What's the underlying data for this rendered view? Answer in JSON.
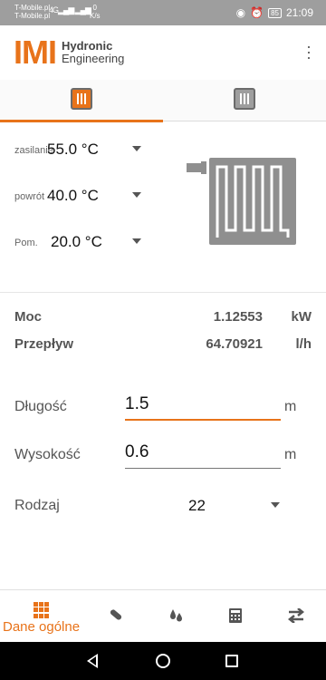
{
  "status_bar": {
    "carrier_1": "T-Mobile.pl",
    "carrier_2": "T-Mobile.pl",
    "signal": "4G",
    "speed_value": "0",
    "speed_unit": "K/s",
    "battery": "85",
    "time": "21:09"
  },
  "header": {
    "logo_mark": "IMI",
    "logo_line1": "Hydronic",
    "logo_line2": "Engineering"
  },
  "tabs": [
    {
      "name": "panel-radiator",
      "active": true
    },
    {
      "name": "vertical-radiator",
      "active": false
    }
  ],
  "temperatures": {
    "supply": {
      "label": "zasilanie",
      "value": "55.0 °C"
    },
    "return": {
      "label": "powrót",
      "value": "40.0 °C"
    },
    "room": {
      "label": "Pom.",
      "value": "20.0 °C"
    }
  },
  "results": {
    "power": {
      "label": "Moc",
      "value": "1.12553",
      "unit": "kW"
    },
    "flow": {
      "label": "Przepływ",
      "value": "64.70921",
      "unit": "l/h"
    }
  },
  "fields": {
    "length": {
      "label": "Długość",
      "value": "1.5",
      "unit": "m"
    },
    "height": {
      "label": "Wysokość",
      "value": "0.6",
      "unit": "m"
    },
    "type": {
      "label": "Rodzaj",
      "value": "22"
    }
  },
  "bottom_nav": {
    "active_label": "Dane ogólne",
    "items": [
      "grid-icon",
      "pipe-icon",
      "drops-icon",
      "calculator-icon",
      "swap-icon"
    ]
  },
  "colors": {
    "accent": "#e8731a",
    "radiator": "#8f8f8f",
    "statusbar": "#9e9e9e"
  }
}
